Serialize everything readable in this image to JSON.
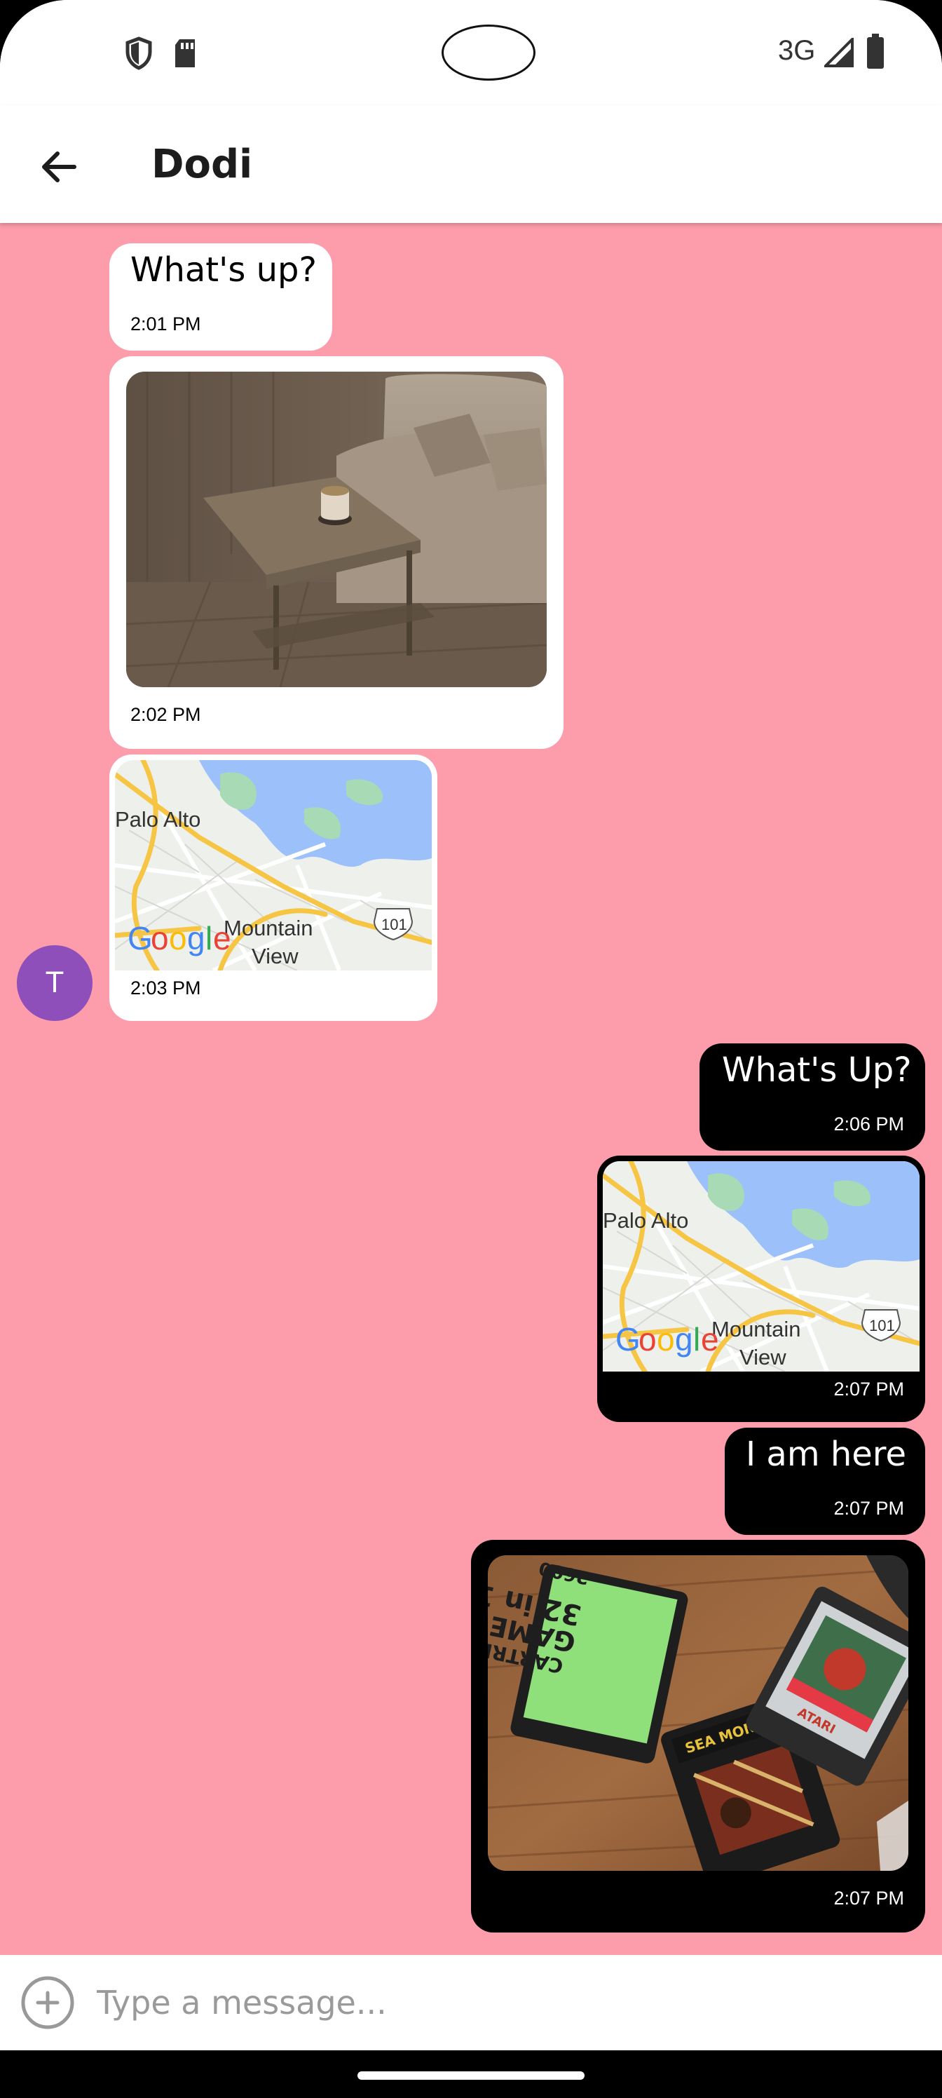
{
  "status_bar": {
    "network": "3G",
    "icons": [
      "shield-icon",
      "sd-card-icon",
      "signal-icon",
      "battery-icon"
    ]
  },
  "app_bar": {
    "title": "Dodi",
    "back_icon": "arrow-back-icon"
  },
  "chat": {
    "background": "#fd9cab",
    "avatar_initial": "T",
    "avatar_color": "#8f4fba",
    "messages": [
      {
        "side": "incoming",
        "type": "text",
        "text": "What's up?",
        "time": "2:01 PM"
      },
      {
        "side": "incoming",
        "type": "image",
        "subject": "sofa-side-table-photo",
        "time": "2:02 PM"
      },
      {
        "side": "incoming",
        "type": "map",
        "labels": [
          "Palo Alto",
          "Mountain",
          "View",
          "101"
        ],
        "brand": "Google",
        "time": "2:03 PM"
      },
      {
        "side": "outgoing",
        "type": "text",
        "text": "What's Up?",
        "time": "2:06 PM"
      },
      {
        "side": "outgoing",
        "type": "map",
        "labels": [
          "Palo Alto",
          "Mountain",
          "View",
          "101"
        ],
        "brand": "Google",
        "time": "2:07 PM"
      },
      {
        "side": "outgoing",
        "type": "text",
        "text": "I am here",
        "time": "2:07 PM"
      },
      {
        "side": "outgoing",
        "type": "image",
        "subject": "game-cartridges-photo",
        "time": "2:07 PM"
      }
    ]
  },
  "composer": {
    "placeholder": "Type a message...",
    "add_icon": "add-circle-icon"
  },
  "colors": {
    "incoming_bubble": "#ffffff",
    "outgoing_bubble": "#000000"
  }
}
